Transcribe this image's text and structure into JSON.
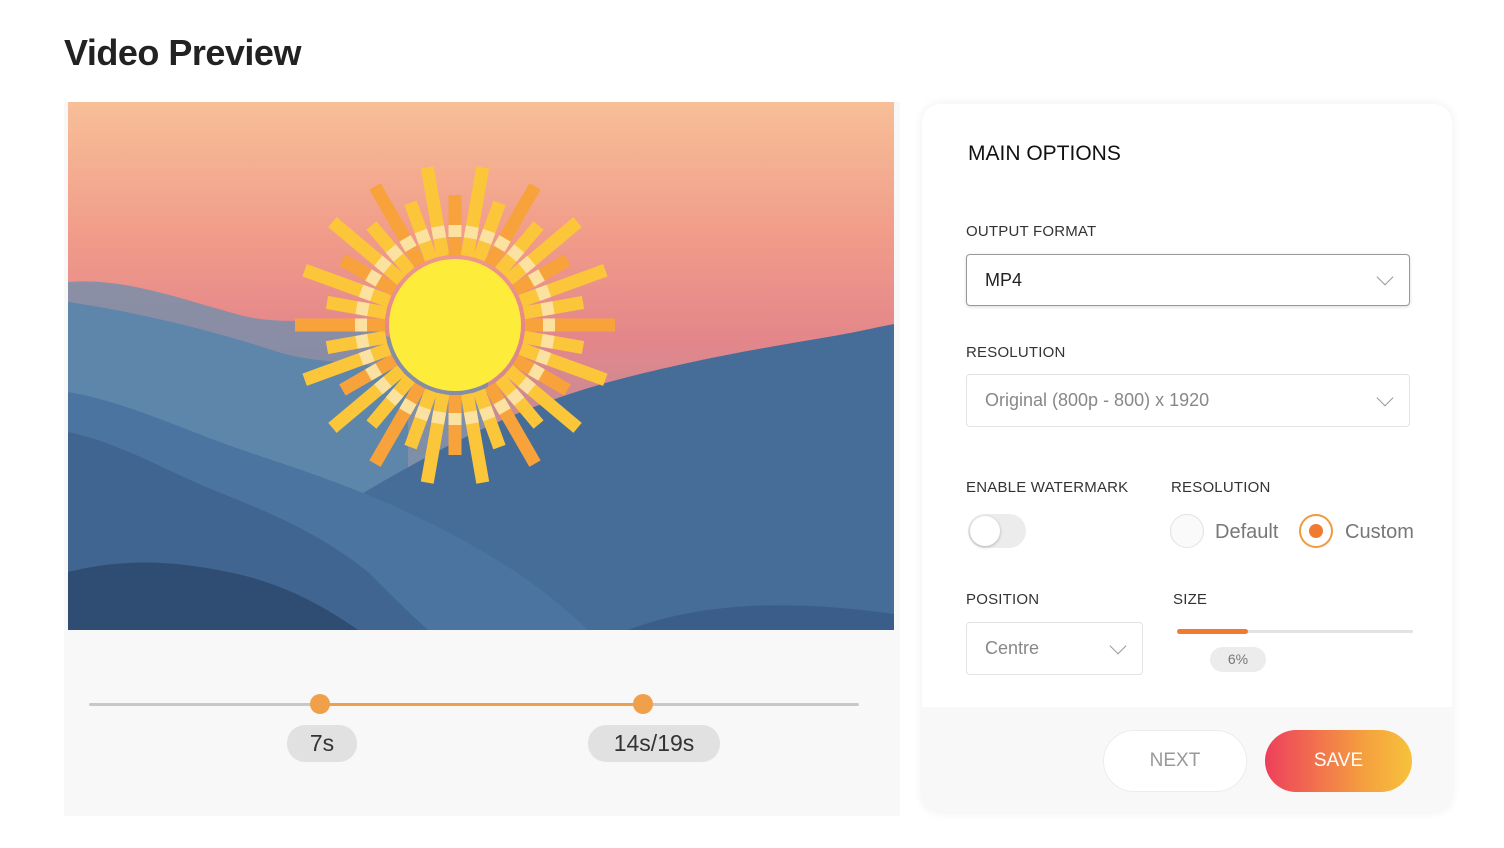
{
  "page": {
    "title": "Video Preview"
  },
  "preview": {
    "media": "sunset-over-mountains-with-sun-illustration",
    "trim": {
      "start_label": "7s",
      "end_label": "14s/19s",
      "start_fraction": 0.3,
      "end_fraction": 0.72
    }
  },
  "options": {
    "title": "MAIN OPTIONS",
    "output_format": {
      "label": "OUTPUT FORMAT",
      "value": "MP4"
    },
    "resolution": {
      "label": "RESOLUTION",
      "value": "Original (800p - 800) x 1920"
    },
    "watermark": {
      "label": "ENABLE WATERMARK",
      "enabled": false
    },
    "watermark_resolution": {
      "label": "RESOLUTION",
      "options": [
        {
          "label": "Default",
          "selected": false
        },
        {
          "label": "Custom",
          "selected": true
        }
      ]
    },
    "position": {
      "label": "POSITION",
      "value": "Centre"
    },
    "size": {
      "label": "SIZE",
      "value_label": "6%",
      "fraction": 0.3
    },
    "buttons": {
      "next": "NEXT",
      "save": "SAVE"
    }
  },
  "colors": {
    "accent": "#f07a30",
    "trim_accent": "#f0a04b",
    "save_gradient_start": "#ee3f5c",
    "save_gradient_end": "#f7c23c"
  }
}
